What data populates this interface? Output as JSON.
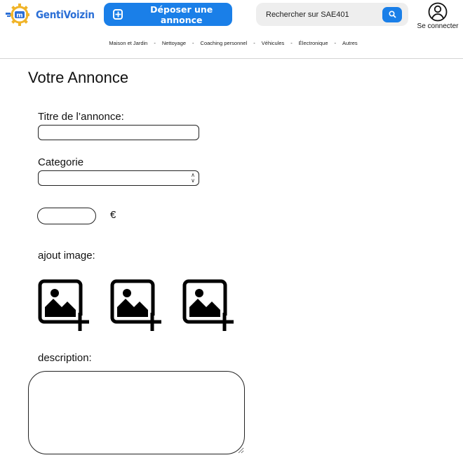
{
  "header": {
    "logo_text": "GentiVoizin",
    "logo_mark_text": "m",
    "post_button_label": "Déposer une annonce",
    "search_placeholder": "Rechercher sur SAE401",
    "account_label": "Se connecter"
  },
  "categories": [
    "Maison et Jardin",
    "Nettoyage",
    "Coaching personnel",
    "Véhicules",
    "Électronique",
    "Autres"
  ],
  "category_separator": "-",
  "form": {
    "title": "Votre Annonce",
    "title_label": "Titre de l’annonce:",
    "category_label": "Categorie",
    "currency_symbol": "€",
    "image_label": "ajout image:",
    "description_label": "description:"
  },
  "icons": {
    "post": "plus-square-icon",
    "search": "search-icon",
    "account": "user-circle-icon",
    "image_add": "image-add-icon"
  },
  "colors": {
    "primary": "#1a7fe8",
    "logo_blue": "#2b6fd6",
    "logo_gear": "#f0b429",
    "search_bg": "#eeeeee"
  }
}
